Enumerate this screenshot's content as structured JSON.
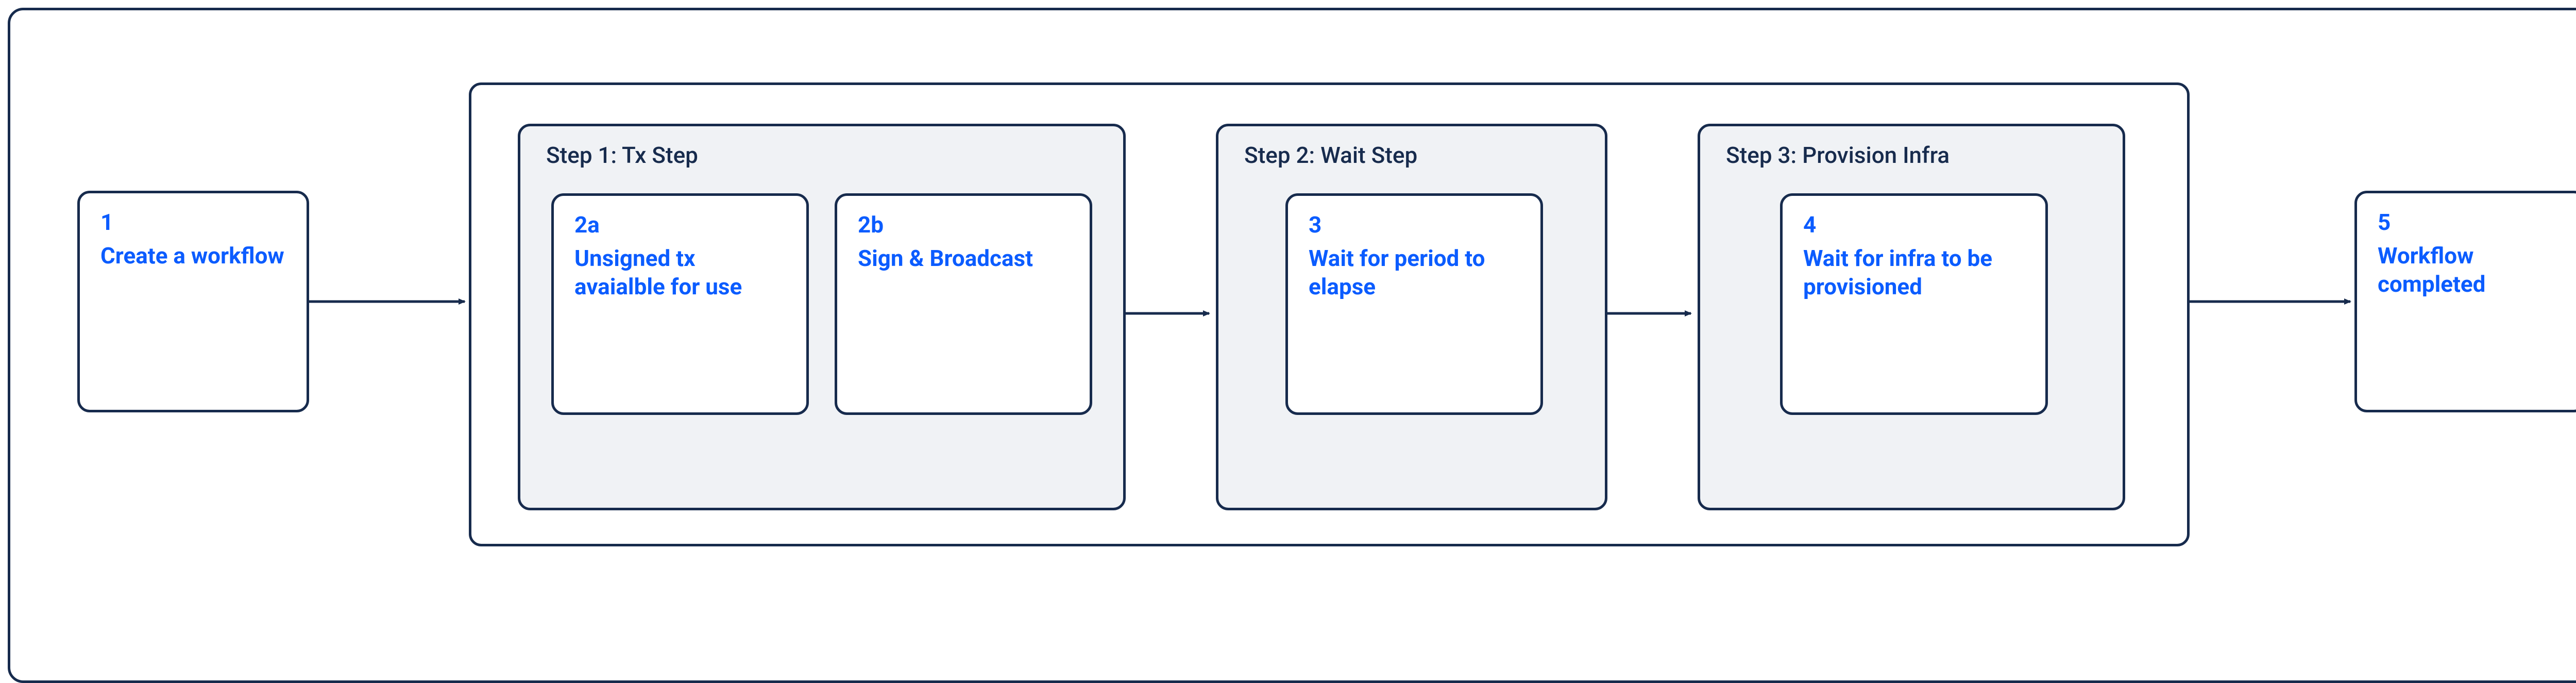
{
  "node1": {
    "num": "1",
    "text": "Create a workflow"
  },
  "group": {
    "step1": {
      "title": "Step 1: Tx Step",
      "a": {
        "num": "2a",
        "text": "Unsigned tx avaialble for use"
      },
      "b": {
        "num": "2b",
        "text": "Sign & Broadcast"
      }
    },
    "step2": {
      "title": "Step 2: Wait Step",
      "item": {
        "num": "3",
        "text": "Wait for period to elapse"
      }
    },
    "step3": {
      "title": "Step 3: Provision Infra",
      "item": {
        "num": "4",
        "text": "Wait for infra to be provisioned"
      }
    }
  },
  "node5": {
    "num": "5",
    "text": "Workflow completed"
  }
}
